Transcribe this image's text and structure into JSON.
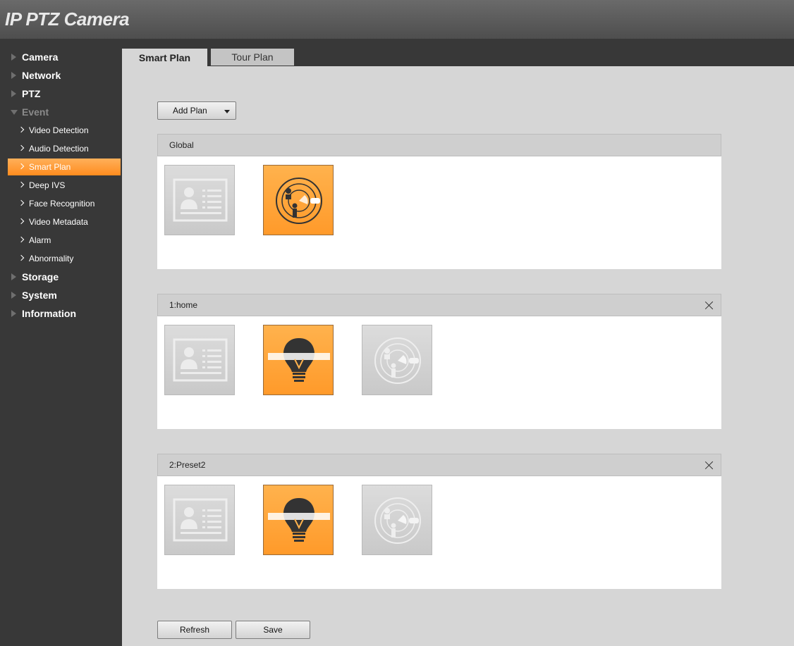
{
  "app": {
    "title": "IP PTZ Camera"
  },
  "sidebar": {
    "items": [
      {
        "label": "Camera"
      },
      {
        "label": "Network"
      },
      {
        "label": "PTZ"
      },
      {
        "label": "Event"
      },
      {
        "label": "Storage"
      },
      {
        "label": "System"
      },
      {
        "label": "Information"
      }
    ],
    "event_sub": [
      {
        "label": "Video Detection"
      },
      {
        "label": "Audio Detection"
      },
      {
        "label": "Smart Plan",
        "active": true
      },
      {
        "label": "Deep IVS"
      },
      {
        "label": "Face Recognition"
      },
      {
        "label": "Video Metadata"
      },
      {
        "label": "Alarm"
      },
      {
        "label": "Abnormality"
      }
    ]
  },
  "tabs": [
    {
      "label": "Smart Plan",
      "active": true
    },
    {
      "label": "Tour Plan",
      "active": false
    }
  ],
  "toolbar": {
    "add_plan_label": "Add Plan"
  },
  "plans": [
    {
      "name": "Global",
      "closable": false,
      "tiles": [
        {
          "icon": "face-card-icon",
          "state": "inactive"
        },
        {
          "icon": "radar-people-icon",
          "state": "active"
        }
      ]
    },
    {
      "name": "1:home",
      "closable": true,
      "tiles": [
        {
          "icon": "face-card-icon",
          "state": "inactive"
        },
        {
          "icon": "lightbulb-ivs-icon",
          "state": "active"
        },
        {
          "icon": "radar-people-icon",
          "state": "disabled"
        }
      ]
    },
    {
      "name": "2:Preset2",
      "closable": true,
      "tiles": [
        {
          "icon": "face-card-icon",
          "state": "inactive"
        },
        {
          "icon": "lightbulb-ivs-icon",
          "state": "active"
        },
        {
          "icon": "radar-people-icon",
          "state": "disabled"
        }
      ]
    }
  ],
  "footer": {
    "refresh_label": "Refresh",
    "save_label": "Save"
  },
  "colors": {
    "accent": "#ff9a2a",
    "sidebar_bg": "#383838",
    "header_bg": "#5a5a5a"
  }
}
